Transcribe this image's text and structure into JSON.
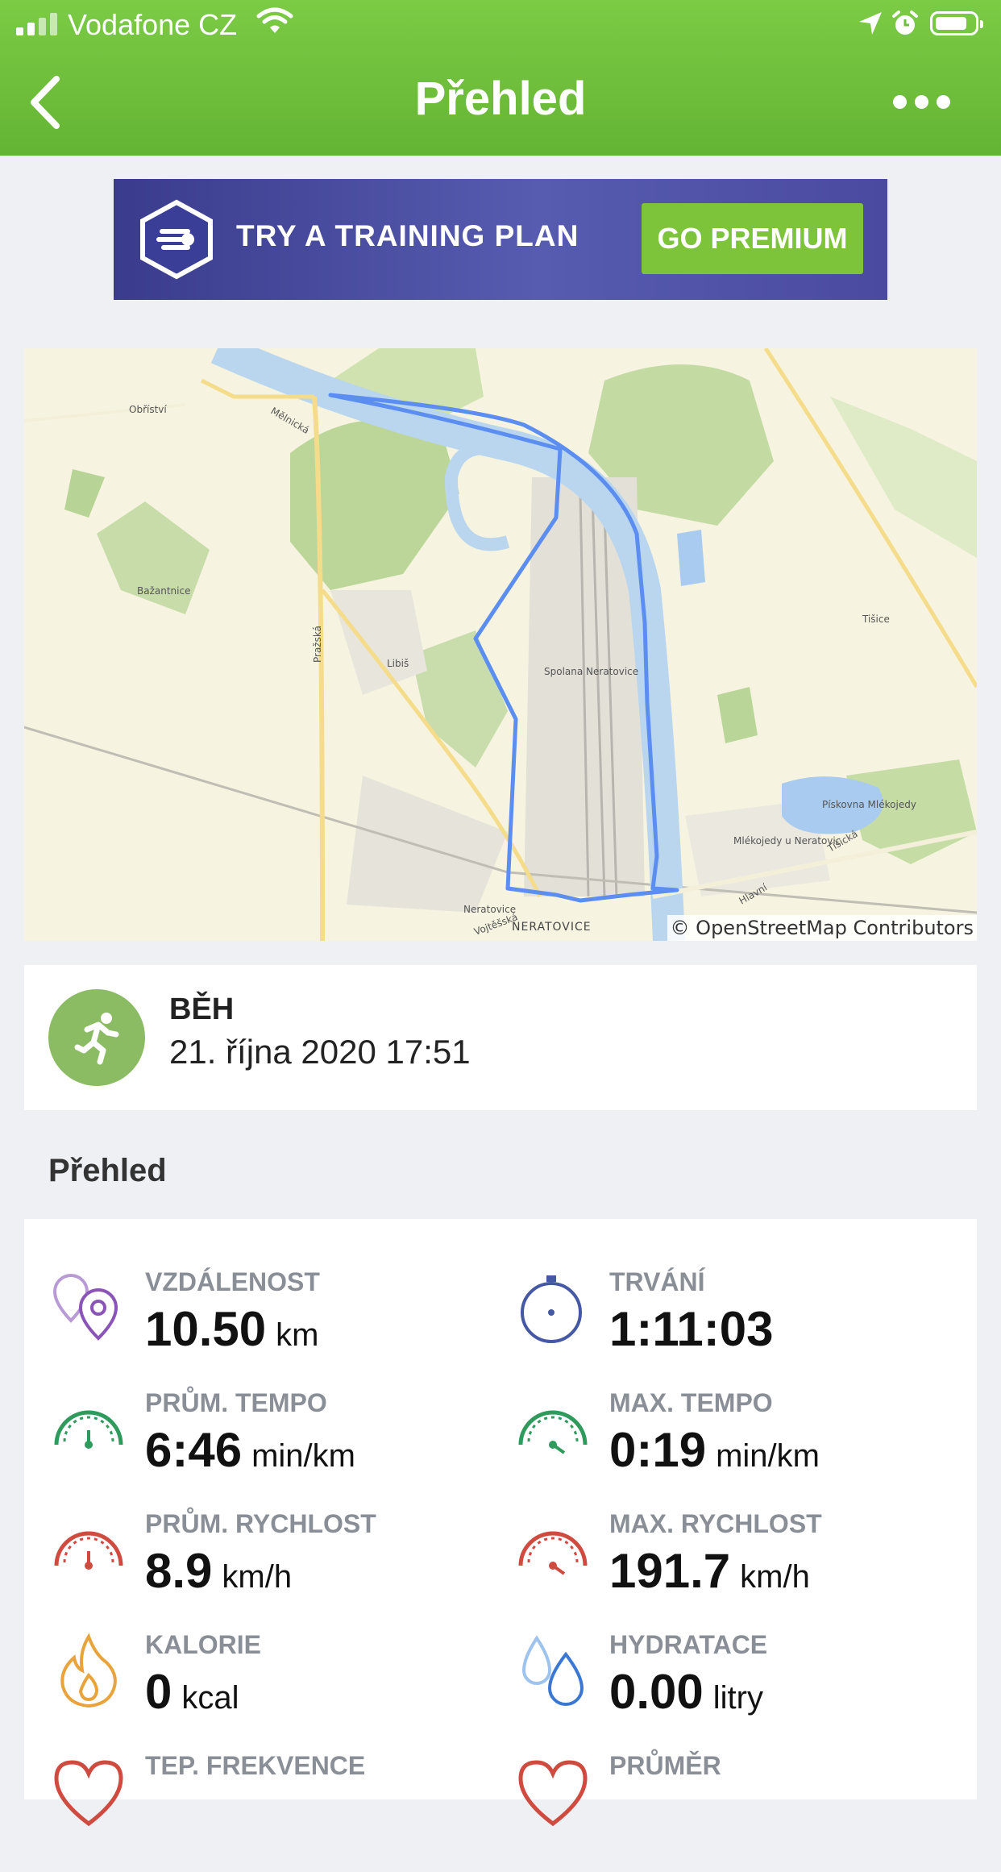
{
  "status_bar": {
    "carrier": "Vodafone CZ"
  },
  "header": {
    "title": "Přehled"
  },
  "banner": {
    "text": "TRY A TRAINING PLAN",
    "button": "GO PREMIUM"
  },
  "map": {
    "attribution": "© OpenStreetMap Contributors",
    "labels": [
      "Obříství",
      "Bažantnice",
      "Libiš",
      "Spolana Neratovice",
      "NERATOVICE",
      "Neratovice",
      "Tišice",
      "Pískovna Mlékojedy",
      "Mlékojedy u Neratovic",
      "Mělnická",
      "Pražská",
      "Tišická",
      "Vojtěšská",
      "Hlavní"
    ]
  },
  "activity": {
    "type": "BĚH",
    "date": "21. října 2020 17:51"
  },
  "overview": {
    "title": "Přehled",
    "stats": [
      {
        "label": "VZDÁLENOST",
        "value": "10.50",
        "unit": "km",
        "icon": "distance-pins-icon"
      },
      {
        "label": "TRVÁNÍ",
        "value": "1:11:03",
        "unit": "",
        "icon": "stopwatch-icon"
      },
      {
        "label": "PRŮM. TEMPO",
        "value": "6:46",
        "unit": "min/km",
        "icon": "pace-gauge-icon"
      },
      {
        "label": "MAX. TEMPO",
        "value": "0:19",
        "unit": "min/km",
        "icon": "pace-gauge-icon"
      },
      {
        "label": "PRŮM. RYCHLOST",
        "value": "8.9",
        "unit": "km/h",
        "icon": "speed-gauge-icon"
      },
      {
        "label": "MAX. RYCHLOST",
        "value": "191.7",
        "unit": "km/h",
        "icon": "speed-gauge-icon"
      },
      {
        "label": "KALORIE",
        "value": "0",
        "unit": "kcal",
        "icon": "flame-icon"
      },
      {
        "label": "HYDRATACE",
        "value": "0.00",
        "unit": "litry",
        "icon": "water-drops-icon"
      },
      {
        "label": "TEP. FREKVENCE",
        "value": "",
        "unit": "",
        "icon": "heart-icon"
      },
      {
        "label": "PRŮMĚR",
        "value": "",
        "unit": "",
        "icon": "heart-icon"
      }
    ]
  },
  "colors": {
    "header_green": "#6cbf3a",
    "route_blue": "#5b8ef0",
    "premium_green": "#7dc43a",
    "banner_purple": "#4b4ca3"
  }
}
